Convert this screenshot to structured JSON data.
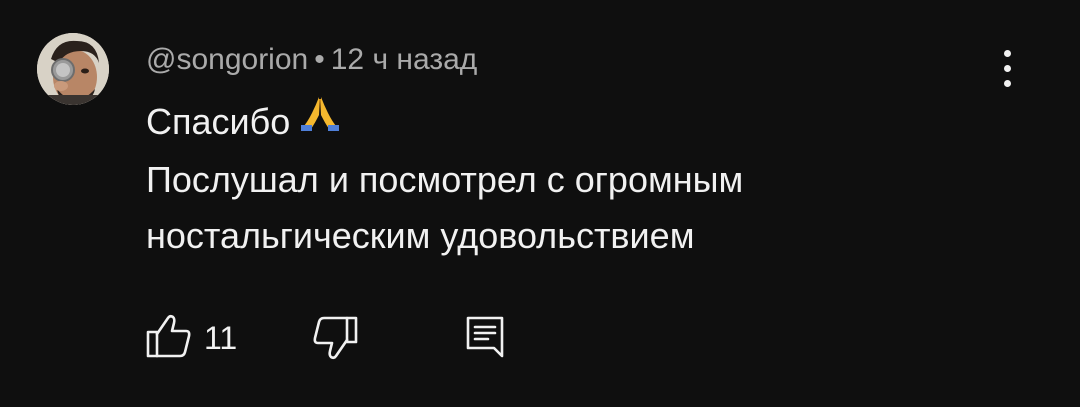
{
  "comment": {
    "author": "@songorion",
    "separator": "•",
    "time": "12 ч назад",
    "text_line1": "Спасибо",
    "emoji": "pray-emoji",
    "text_line2": "Послушал и посмотрел с огромным",
    "text_line3": "ностальгическим удовольствием",
    "likes": "11"
  },
  "icons": {
    "like": "thumb-up-icon",
    "dislike": "thumb-down-icon",
    "reply": "reply-icon",
    "more": "more-vert-icon"
  },
  "colors": {
    "background": "#0f0f0f",
    "text": "#f1f1f1",
    "meta": "#aaaaaa"
  }
}
